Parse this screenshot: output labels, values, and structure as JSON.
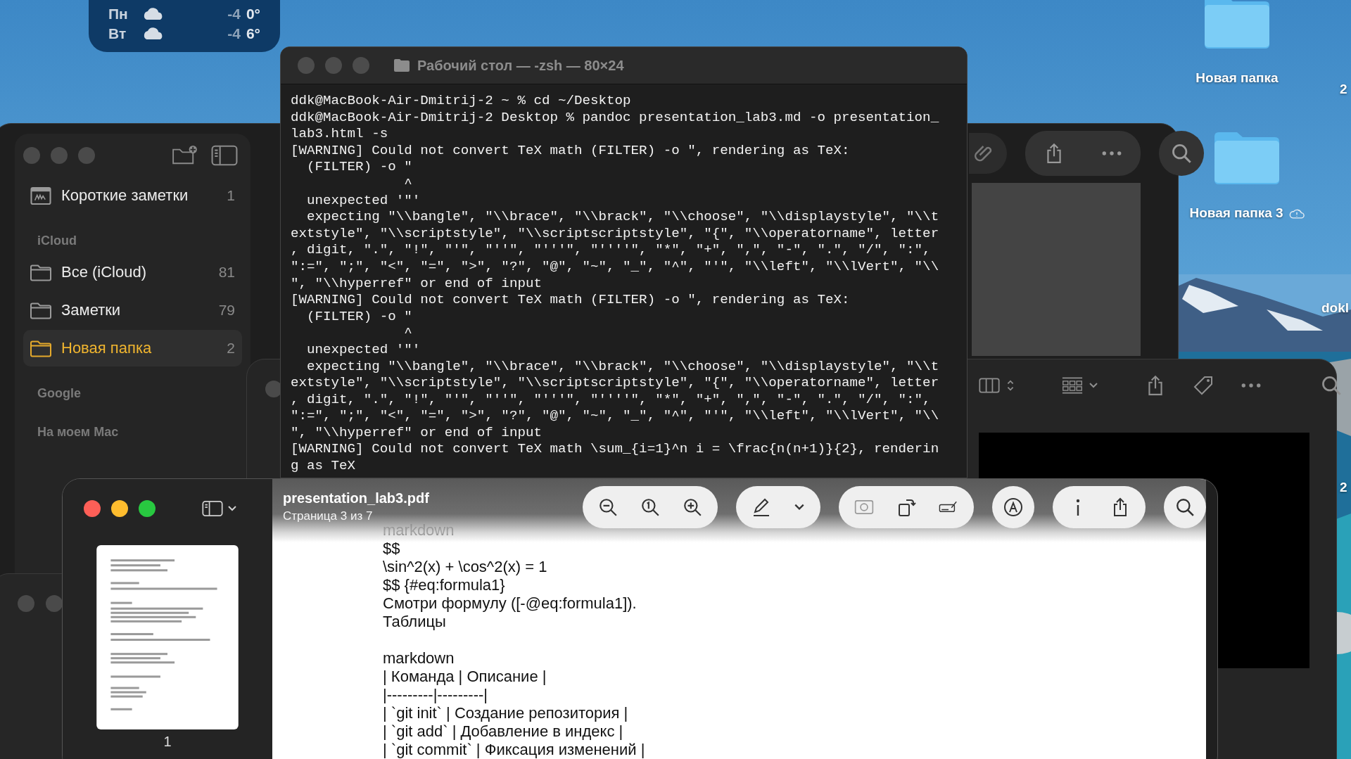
{
  "weather": {
    "days": [
      {
        "day": "Пн",
        "low": "-4",
        "high": "0°"
      },
      {
        "day": "Вт",
        "low": "-4",
        "high": "6°"
      }
    ]
  },
  "desktop_icons": [
    {
      "label": "Новая папка",
      "cloud": false
    },
    {
      "label": "Новая папка 3",
      "cloud": true
    }
  ],
  "desktop_edge_labels": [
    "2",
    "dokl",
    "2"
  ],
  "notes": {
    "quick": {
      "label": "Короткие заметки",
      "count": "1"
    },
    "sections": [
      {
        "title": "iCloud",
        "items": [
          {
            "label": "Все (iCloud)",
            "count": "81",
            "selected": false
          },
          {
            "label": "Заметки",
            "count": "79",
            "selected": false
          },
          {
            "label": "Новая папка",
            "count": "2",
            "selected": true
          }
        ]
      },
      {
        "title": "Google"
      },
      {
        "title": "На моем Mac"
      }
    ]
  },
  "terminal": {
    "title": "Рабочий стол — -zsh — 80×24",
    "lines": [
      "ddk@MacBook-Air-Dmitrij-2 ~ % cd ~/Desktop",
      "ddk@MacBook-Air-Dmitrij-2 Desktop % pandoc presentation_lab3.md -o presentation_",
      "lab3.html -s",
      "[WARNING] Could not convert TeX math (FILTER) -o \", rendering as TeX:",
      "  (FILTER) -o \"",
      "              ^",
      "  unexpected '\"'",
      "  expecting \"\\\\bangle\", \"\\\\brace\", \"\\\\brack\", \"\\\\choose\", \"\\\\displaystyle\", \"\\\\t",
      "extstyle\", \"\\\\scriptstyle\", \"\\\\scriptscriptstyle\", \"{\", \"\\\\operatorname\", letter",
      ", digit, \".\", \"!\", \"'\", \"''\", \"'''\", \"''''\", \"*\", \"+\", \",\", \"-\", \".\", \"/\", \":\",",
      "\":=\", \";\", \"<\", \"=\", \">\", \"?\", \"@\", \"~\", \"_\", \"^\", \"'\", \"\\\\left\", \"\\\\lVert\", \"\\\\",
      "\", \"\\\\hyperref\" or end of input",
      "[WARNING] Could not convert TeX math (FILTER) -o \", rendering as TeX:",
      "  (FILTER) -o \"",
      "              ^",
      "  unexpected '\"'",
      "  expecting \"\\\\bangle\", \"\\\\brace\", \"\\\\brack\", \"\\\\choose\", \"\\\\displaystyle\", \"\\\\t",
      "extstyle\", \"\\\\scriptstyle\", \"\\\\scriptscriptstyle\", \"{\", \"\\\\operatorname\", letter",
      ", digit, \".\", \"!\", \"'\", \"''\", \"'''\", \"''''\", \"*\", \"+\", \",\", \"-\", \".\", \"/\", \":\",",
      "\":=\", \";\", \"<\", \"=\", \">\", \"?\", \"@\", \"~\", \"_\", \"^\", \"'\", \"\\\\left\", \"\\\\lVert\", \"\\\\",
      "\", \"\\\\hyperref\" or end of input",
      "[WARNING] Could not convert TeX math \\sum_{i=1}^n i = \\frac{n(n+1)}{2}, renderin",
      "g as TeX"
    ]
  },
  "preview": {
    "title": "presentation_lab3.pdf",
    "subtitle": "Страница 3 из 7",
    "thumbnails": [
      {
        "label": "1"
      }
    ],
    "paragraphs": [
      [
        "markdown",
        "$$",
        "\\sin^2(x) + \\cos^2(x) = 1",
        "$$ {#eq:formula1}",
        "Смотри формулу ([-@eq:formula1]).",
        "Таблицы"
      ],
      [
        "markdown",
        "| Команда | Описание |",
        "|---------|---------|",
        "| `git init` | Создание репозитория |",
        "| `git add` | Добавление в индекс |",
        "| `git commit` | Фиксация изменений |"
      ]
    ]
  }
}
